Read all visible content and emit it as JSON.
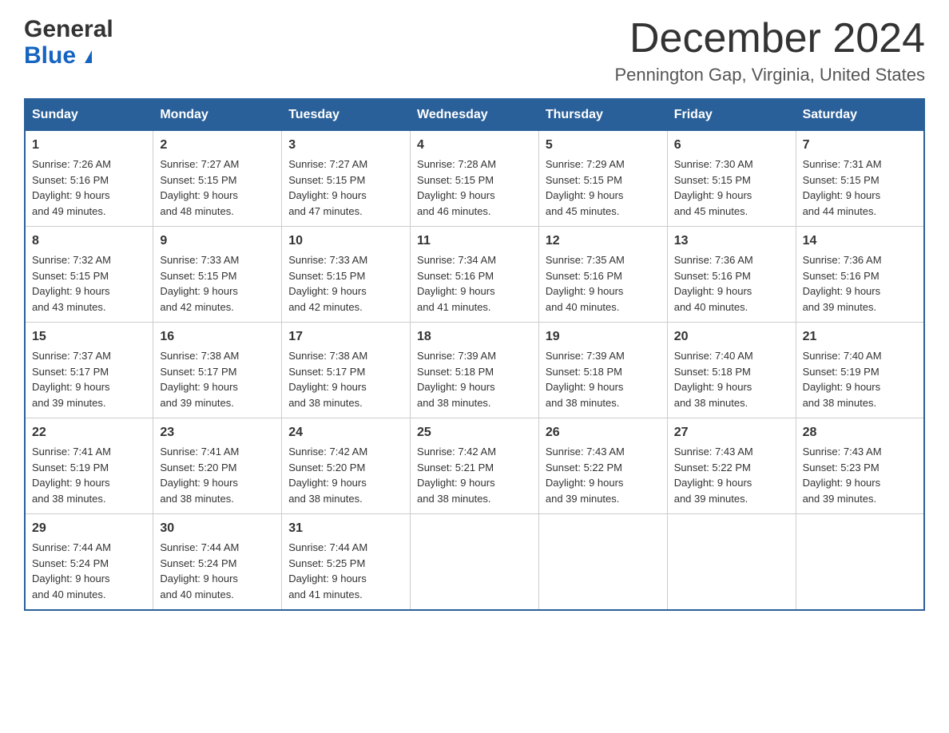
{
  "header": {
    "logo_general": "General",
    "logo_blue": "Blue",
    "month_title": "December 2024",
    "location": "Pennington Gap, Virginia, United States"
  },
  "days_of_week": [
    "Sunday",
    "Monday",
    "Tuesday",
    "Wednesday",
    "Thursday",
    "Friday",
    "Saturday"
  ],
  "weeks": [
    [
      {
        "day": "1",
        "sunrise": "Sunrise: 7:26 AM",
        "sunset": "Sunset: 5:16 PM",
        "daylight": "Daylight: 9 hours",
        "daylight2": "and 49 minutes."
      },
      {
        "day": "2",
        "sunrise": "Sunrise: 7:27 AM",
        "sunset": "Sunset: 5:15 PM",
        "daylight": "Daylight: 9 hours",
        "daylight2": "and 48 minutes."
      },
      {
        "day": "3",
        "sunrise": "Sunrise: 7:27 AM",
        "sunset": "Sunset: 5:15 PM",
        "daylight": "Daylight: 9 hours",
        "daylight2": "and 47 minutes."
      },
      {
        "day": "4",
        "sunrise": "Sunrise: 7:28 AM",
        "sunset": "Sunset: 5:15 PM",
        "daylight": "Daylight: 9 hours",
        "daylight2": "and 46 minutes."
      },
      {
        "day": "5",
        "sunrise": "Sunrise: 7:29 AM",
        "sunset": "Sunset: 5:15 PM",
        "daylight": "Daylight: 9 hours",
        "daylight2": "and 45 minutes."
      },
      {
        "day": "6",
        "sunrise": "Sunrise: 7:30 AM",
        "sunset": "Sunset: 5:15 PM",
        "daylight": "Daylight: 9 hours",
        "daylight2": "and 45 minutes."
      },
      {
        "day": "7",
        "sunrise": "Sunrise: 7:31 AM",
        "sunset": "Sunset: 5:15 PM",
        "daylight": "Daylight: 9 hours",
        "daylight2": "and 44 minutes."
      }
    ],
    [
      {
        "day": "8",
        "sunrise": "Sunrise: 7:32 AM",
        "sunset": "Sunset: 5:15 PM",
        "daylight": "Daylight: 9 hours",
        "daylight2": "and 43 minutes."
      },
      {
        "day": "9",
        "sunrise": "Sunrise: 7:33 AM",
        "sunset": "Sunset: 5:15 PM",
        "daylight": "Daylight: 9 hours",
        "daylight2": "and 42 minutes."
      },
      {
        "day": "10",
        "sunrise": "Sunrise: 7:33 AM",
        "sunset": "Sunset: 5:15 PM",
        "daylight": "Daylight: 9 hours",
        "daylight2": "and 42 minutes."
      },
      {
        "day": "11",
        "sunrise": "Sunrise: 7:34 AM",
        "sunset": "Sunset: 5:16 PM",
        "daylight": "Daylight: 9 hours",
        "daylight2": "and 41 minutes."
      },
      {
        "day": "12",
        "sunrise": "Sunrise: 7:35 AM",
        "sunset": "Sunset: 5:16 PM",
        "daylight": "Daylight: 9 hours",
        "daylight2": "and 40 minutes."
      },
      {
        "day": "13",
        "sunrise": "Sunrise: 7:36 AM",
        "sunset": "Sunset: 5:16 PM",
        "daylight": "Daylight: 9 hours",
        "daylight2": "and 40 minutes."
      },
      {
        "day": "14",
        "sunrise": "Sunrise: 7:36 AM",
        "sunset": "Sunset: 5:16 PM",
        "daylight": "Daylight: 9 hours",
        "daylight2": "and 39 minutes."
      }
    ],
    [
      {
        "day": "15",
        "sunrise": "Sunrise: 7:37 AM",
        "sunset": "Sunset: 5:17 PM",
        "daylight": "Daylight: 9 hours",
        "daylight2": "and 39 minutes."
      },
      {
        "day": "16",
        "sunrise": "Sunrise: 7:38 AM",
        "sunset": "Sunset: 5:17 PM",
        "daylight": "Daylight: 9 hours",
        "daylight2": "and 39 minutes."
      },
      {
        "day": "17",
        "sunrise": "Sunrise: 7:38 AM",
        "sunset": "Sunset: 5:17 PM",
        "daylight": "Daylight: 9 hours",
        "daylight2": "and 38 minutes."
      },
      {
        "day": "18",
        "sunrise": "Sunrise: 7:39 AM",
        "sunset": "Sunset: 5:18 PM",
        "daylight": "Daylight: 9 hours",
        "daylight2": "and 38 minutes."
      },
      {
        "day": "19",
        "sunrise": "Sunrise: 7:39 AM",
        "sunset": "Sunset: 5:18 PM",
        "daylight": "Daylight: 9 hours",
        "daylight2": "and 38 minutes."
      },
      {
        "day": "20",
        "sunrise": "Sunrise: 7:40 AM",
        "sunset": "Sunset: 5:18 PM",
        "daylight": "Daylight: 9 hours",
        "daylight2": "and 38 minutes."
      },
      {
        "day": "21",
        "sunrise": "Sunrise: 7:40 AM",
        "sunset": "Sunset: 5:19 PM",
        "daylight": "Daylight: 9 hours",
        "daylight2": "and 38 minutes."
      }
    ],
    [
      {
        "day": "22",
        "sunrise": "Sunrise: 7:41 AM",
        "sunset": "Sunset: 5:19 PM",
        "daylight": "Daylight: 9 hours",
        "daylight2": "and 38 minutes."
      },
      {
        "day": "23",
        "sunrise": "Sunrise: 7:41 AM",
        "sunset": "Sunset: 5:20 PM",
        "daylight": "Daylight: 9 hours",
        "daylight2": "and 38 minutes."
      },
      {
        "day": "24",
        "sunrise": "Sunrise: 7:42 AM",
        "sunset": "Sunset: 5:20 PM",
        "daylight": "Daylight: 9 hours",
        "daylight2": "and 38 minutes."
      },
      {
        "day": "25",
        "sunrise": "Sunrise: 7:42 AM",
        "sunset": "Sunset: 5:21 PM",
        "daylight": "Daylight: 9 hours",
        "daylight2": "and 38 minutes."
      },
      {
        "day": "26",
        "sunrise": "Sunrise: 7:43 AM",
        "sunset": "Sunset: 5:22 PM",
        "daylight": "Daylight: 9 hours",
        "daylight2": "and 39 minutes."
      },
      {
        "day": "27",
        "sunrise": "Sunrise: 7:43 AM",
        "sunset": "Sunset: 5:22 PM",
        "daylight": "Daylight: 9 hours",
        "daylight2": "and 39 minutes."
      },
      {
        "day": "28",
        "sunrise": "Sunrise: 7:43 AM",
        "sunset": "Sunset: 5:23 PM",
        "daylight": "Daylight: 9 hours",
        "daylight2": "and 39 minutes."
      }
    ],
    [
      {
        "day": "29",
        "sunrise": "Sunrise: 7:44 AM",
        "sunset": "Sunset: 5:24 PM",
        "daylight": "Daylight: 9 hours",
        "daylight2": "and 40 minutes."
      },
      {
        "day": "30",
        "sunrise": "Sunrise: 7:44 AM",
        "sunset": "Sunset: 5:24 PM",
        "daylight": "Daylight: 9 hours",
        "daylight2": "and 40 minutes."
      },
      {
        "day": "31",
        "sunrise": "Sunrise: 7:44 AM",
        "sunset": "Sunset: 5:25 PM",
        "daylight": "Daylight: 9 hours",
        "daylight2": "and 41 minutes."
      },
      {
        "day": "",
        "sunrise": "",
        "sunset": "",
        "daylight": "",
        "daylight2": ""
      },
      {
        "day": "",
        "sunrise": "",
        "sunset": "",
        "daylight": "",
        "daylight2": ""
      },
      {
        "day": "",
        "sunrise": "",
        "sunset": "",
        "daylight": "",
        "daylight2": ""
      },
      {
        "day": "",
        "sunrise": "",
        "sunset": "",
        "daylight": "",
        "daylight2": ""
      }
    ]
  ]
}
